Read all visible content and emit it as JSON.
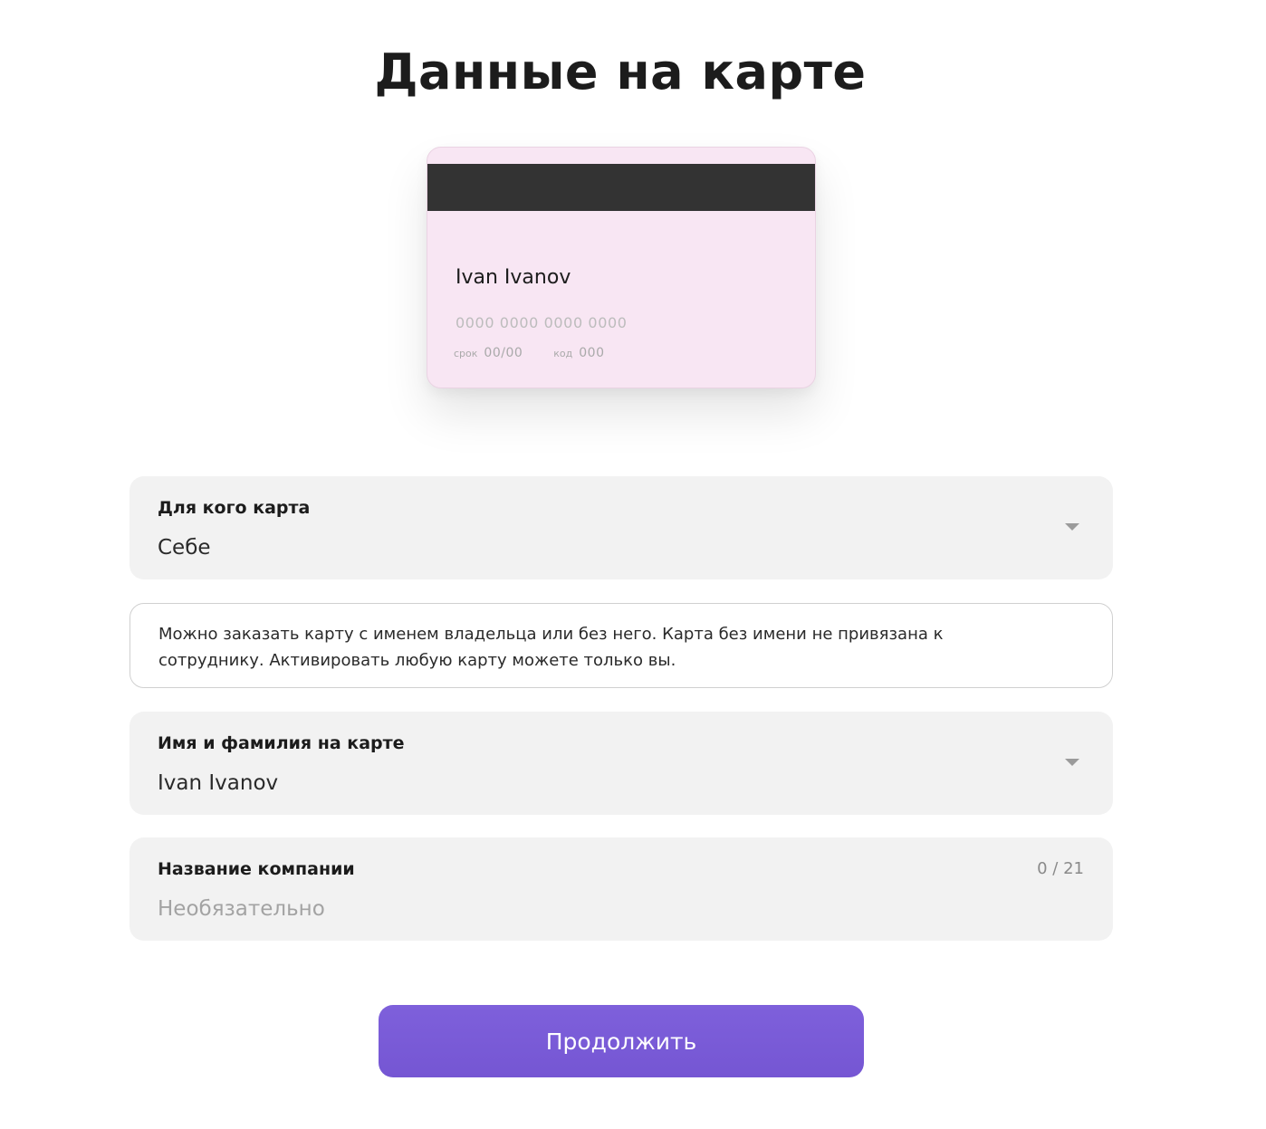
{
  "page": {
    "title": "Данные на карте"
  },
  "card_preview": {
    "holder_name": "Ivan Ivanov",
    "number_placeholder": "0000 0000 0000 0000",
    "expiry_label": "срок",
    "expiry_value": "00/00",
    "code_label": "код",
    "code_value": "000",
    "background_color": "#f8e6f3",
    "stripe_color": "#333333"
  },
  "fields": {
    "card_for": {
      "label": "Для кого карта",
      "value": "Себе",
      "icon": "chevron-down-icon"
    },
    "info": {
      "text": "Можно заказать карту с именем владельца или без него. Карта без имени не привязана к сотруднику. Активировать любую карту можете только вы."
    },
    "name_on_card": {
      "label": "Имя и фамилия на карте",
      "value": "Ivan Ivanov",
      "icon": "chevron-down-icon"
    },
    "company_name": {
      "label": "Название компании",
      "placeholder": "Необязательно",
      "counter": "0 / 21"
    }
  },
  "actions": {
    "continue_label": "Продолжить",
    "accent_color": "#7a5bd8"
  }
}
